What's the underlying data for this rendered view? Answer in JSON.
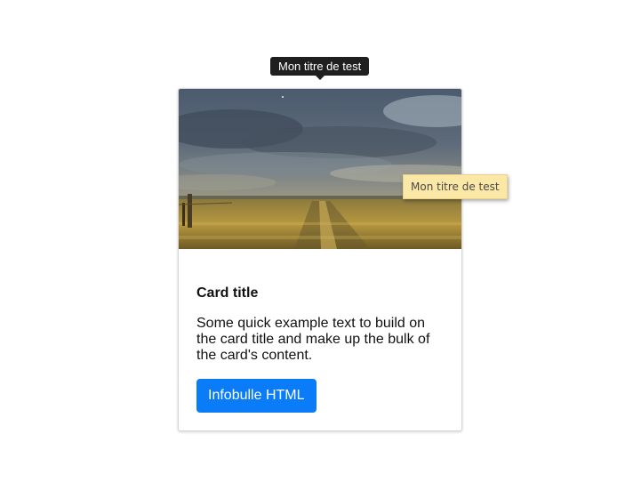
{
  "tooltips": {
    "dark_text": "Mon titre de test",
    "yellow_text": "Mon titre de test"
  },
  "card": {
    "image_description_icon": "landscape-photo",
    "title": "Card title",
    "text": "Some quick example text to build on the card title and make up the bulk of the card's content.",
    "button_label": "Infobulle HTML"
  },
  "colors": {
    "button": "#0a7cf8",
    "dark_tooltip": "#1f1f1f",
    "yellow_tooltip": "#fbe7a6"
  }
}
